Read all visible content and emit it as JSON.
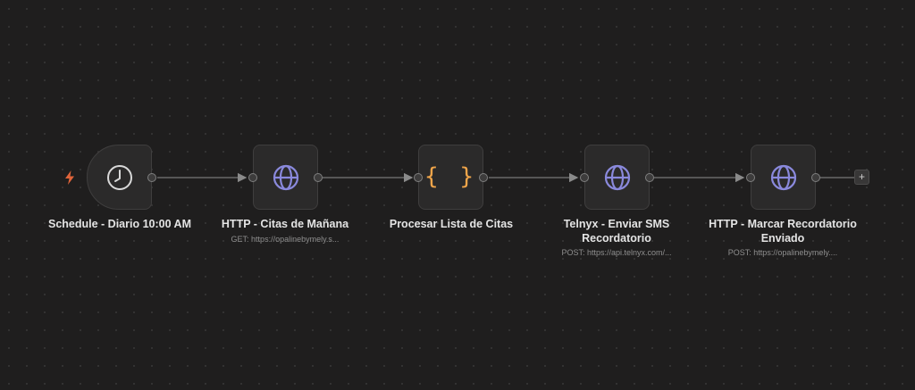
{
  "nodes": [
    {
      "id": "schedule",
      "title": "Schedule - Diario 10:00 AM",
      "subtitle": "",
      "icon": "clock-icon"
    },
    {
      "id": "http-citas",
      "title": "HTTP - Citas de Mañana",
      "subtitle": "GET: https://opalinebymely.s...",
      "icon": "globe-icon"
    },
    {
      "id": "procesar",
      "title": "Procesar Lista de Citas",
      "subtitle": "",
      "icon": "code-braces-icon",
      "glyph": "{ }"
    },
    {
      "id": "telnyx",
      "title": "Telnyx - Enviar SMS Recordatorio",
      "subtitle": "POST: https://api.telnyx.com/...",
      "icon": "globe-icon"
    },
    {
      "id": "http-marcar",
      "title": "HTTP - Marcar Recordatorio Enviado",
      "subtitle": "POST: https://opalinebymely....",
      "icon": "globe-icon"
    }
  ],
  "add_button": {
    "label": "+",
    "icon": "plus-icon"
  },
  "trigger_marker": {
    "icon": "lightning-bolt-icon"
  },
  "colors": {
    "canvas_bg": "#1f1e1e",
    "node_bg": "#2b2a2a",
    "globe": "#8a89dc",
    "braces": "#f0a54a",
    "bolt": "#e0643a",
    "edge": "#777777"
  }
}
